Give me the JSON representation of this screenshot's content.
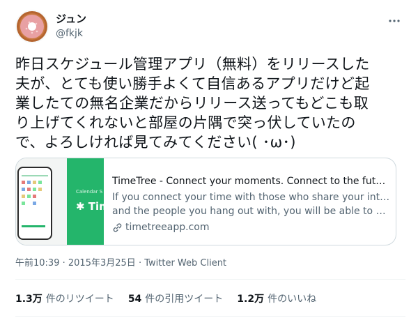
{
  "author": {
    "display_name": "ジュン",
    "handle": "@fkjk"
  },
  "tweet": {
    "text": "昨日スケジュール管理アプリ（無料）をリリースした\n夫が、とても使い勝手よくて自信あるアプリだけど起\n業したての無名企業だからリリース送ってもどこも取\nり上げてくれないと部屋の片隅で突っ伏していたの\nで、よろしければ見てみてください( ･ω･)"
  },
  "card": {
    "media_caption": "Calendar S",
    "media_logo": "✱ Tim",
    "title": "TimeTree - Connect your moments. Connect to the future.",
    "description_line1": "If you connect your time with those who share your interests",
    "description_line2": "and the people you hang out with, you will be able to plan a...",
    "domain": "timetreeapp.com"
  },
  "meta": {
    "time": "午前10:39",
    "separator": "·",
    "date": "2015年3月25日",
    "client": "Twitter Web Client"
  },
  "stats": [
    {
      "count": "1.3万",
      "label": "件のリツイート"
    },
    {
      "count": "54",
      "label": "件の引用ツイート"
    },
    {
      "count": "1.2万",
      "label": "件のいいね"
    }
  ],
  "colors": {
    "accent_green": "#24b56b",
    "secondary_text": "#536471",
    "border": "#cfd9de"
  }
}
